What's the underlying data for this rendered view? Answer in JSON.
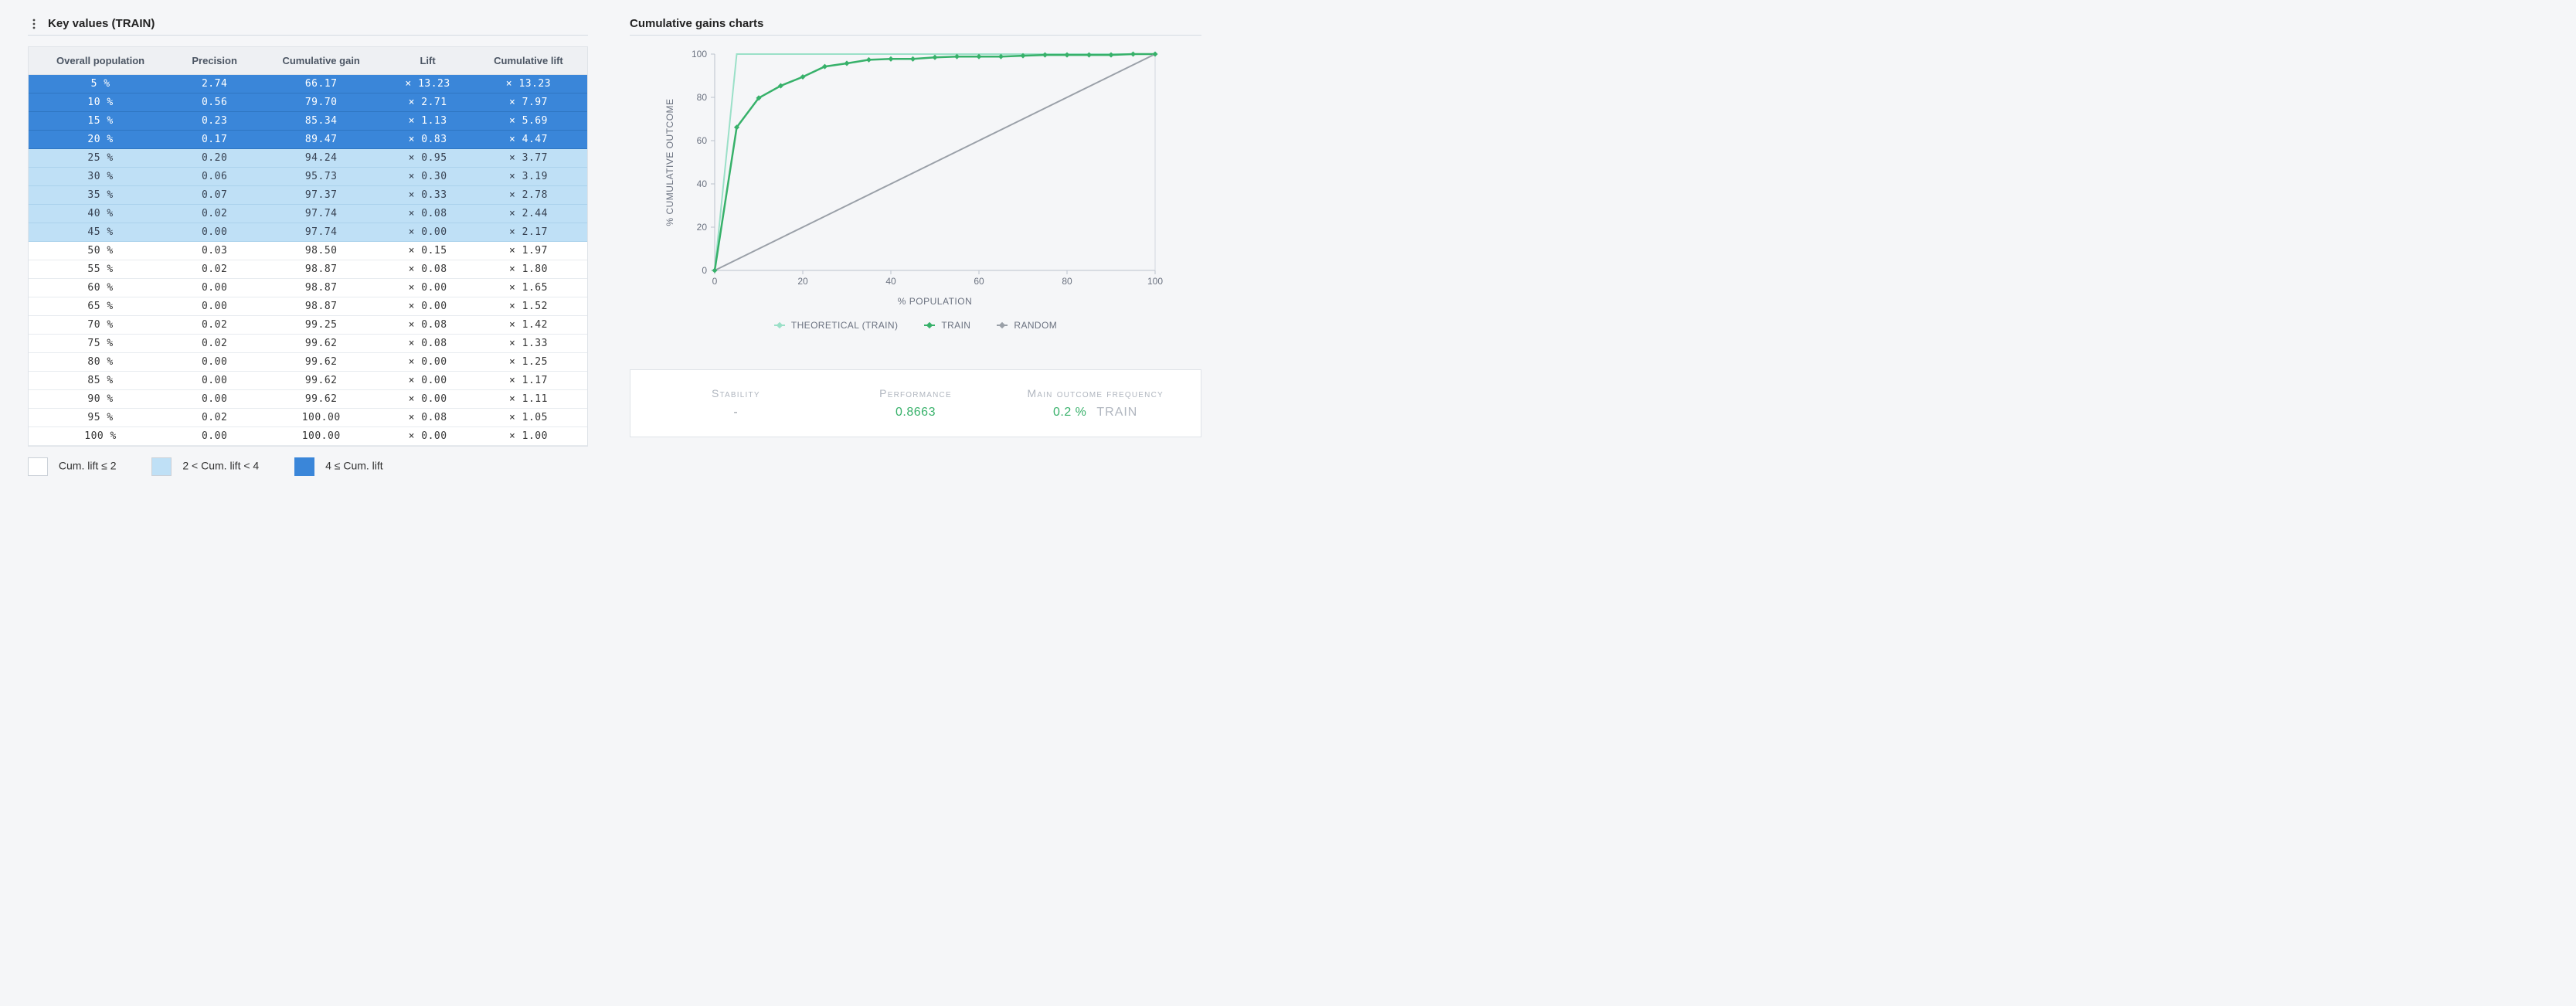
{
  "colors": {
    "band_high": "#3a86d9",
    "band_mid": "#bfe0f6",
    "band_low": "#ffffff",
    "series_train": "#37b16a",
    "series_theoretical": "#9be0c8",
    "series_random": "#9aa0a8"
  },
  "left": {
    "title": "Key values (TRAIN)",
    "columns": [
      "Overall population",
      "Precision",
      "Cumulative gain",
      "Lift",
      "Cumulative lift"
    ],
    "rows": [
      {
        "pop": "5 %",
        "precision": "2.74",
        "cum_gain": "66.17",
        "lift": "× 13.23",
        "cum_lift": "× 13.23",
        "band": "high"
      },
      {
        "pop": "10 %",
        "precision": "0.56",
        "cum_gain": "79.70",
        "lift": "× 2.71",
        "cum_lift": "× 7.97",
        "band": "high"
      },
      {
        "pop": "15 %",
        "precision": "0.23",
        "cum_gain": "85.34",
        "lift": "× 1.13",
        "cum_lift": "× 5.69",
        "band": "high"
      },
      {
        "pop": "20 %",
        "precision": "0.17",
        "cum_gain": "89.47",
        "lift": "× 0.83",
        "cum_lift": "× 4.47",
        "band": "high"
      },
      {
        "pop": "25 %",
        "precision": "0.20",
        "cum_gain": "94.24",
        "lift": "× 0.95",
        "cum_lift": "× 3.77",
        "band": "mid"
      },
      {
        "pop": "30 %",
        "precision": "0.06",
        "cum_gain": "95.73",
        "lift": "× 0.30",
        "cum_lift": "× 3.19",
        "band": "mid"
      },
      {
        "pop": "35 %",
        "precision": "0.07",
        "cum_gain": "97.37",
        "lift": "× 0.33",
        "cum_lift": "× 2.78",
        "band": "mid"
      },
      {
        "pop": "40 %",
        "precision": "0.02",
        "cum_gain": "97.74",
        "lift": "× 0.08",
        "cum_lift": "× 2.44",
        "band": "mid"
      },
      {
        "pop": "45 %",
        "precision": "0.00",
        "cum_gain": "97.74",
        "lift": "× 0.00",
        "cum_lift": "× 2.17",
        "band": "mid"
      },
      {
        "pop": "50 %",
        "precision": "0.03",
        "cum_gain": "98.50",
        "lift": "× 0.15",
        "cum_lift": "× 1.97",
        "band": "low"
      },
      {
        "pop": "55 %",
        "precision": "0.02",
        "cum_gain": "98.87",
        "lift": "× 0.08",
        "cum_lift": "× 1.80",
        "band": "low"
      },
      {
        "pop": "60 %",
        "precision": "0.00",
        "cum_gain": "98.87",
        "lift": "× 0.00",
        "cum_lift": "× 1.65",
        "band": "low"
      },
      {
        "pop": "65 %",
        "precision": "0.00",
        "cum_gain": "98.87",
        "lift": "× 0.00",
        "cum_lift": "× 1.52",
        "band": "low"
      },
      {
        "pop": "70 %",
        "precision": "0.02",
        "cum_gain": "99.25",
        "lift": "× 0.08",
        "cum_lift": "× 1.42",
        "band": "low"
      },
      {
        "pop": "75 %",
        "precision": "0.02",
        "cum_gain": "99.62",
        "lift": "× 0.08",
        "cum_lift": "× 1.33",
        "band": "low"
      },
      {
        "pop": "80 %",
        "precision": "0.00",
        "cum_gain": "99.62",
        "lift": "× 0.00",
        "cum_lift": "× 1.25",
        "band": "low"
      },
      {
        "pop": "85 %",
        "precision": "0.00",
        "cum_gain": "99.62",
        "lift": "× 0.00",
        "cum_lift": "× 1.17",
        "band": "low"
      },
      {
        "pop": "90 %",
        "precision": "0.00",
        "cum_gain": "99.62",
        "lift": "× 0.00",
        "cum_lift": "× 1.11",
        "band": "low"
      },
      {
        "pop": "95 %",
        "precision": "0.02",
        "cum_gain": "100.00",
        "lift": "× 0.08",
        "cum_lift": "× 1.05",
        "band": "low"
      },
      {
        "pop": "100 %",
        "precision": "0.00",
        "cum_gain": "100.00",
        "lift": "× 0.00",
        "cum_lift": "× 1.00",
        "band": "low"
      }
    ],
    "legend": {
      "low": "Cum. lift ≤ 2",
      "mid": "2 < Cum. lift < 4",
      "high": "4 ≤ Cum. lift"
    }
  },
  "right": {
    "title": "Cumulative gains charts",
    "xlabel": "% POPULATION",
    "ylabel": "% CUMULATIVE OUTCOME",
    "xticks": [
      0,
      20,
      40,
      60,
      80,
      100
    ],
    "yticks": [
      0,
      20,
      40,
      60,
      80,
      100
    ],
    "legend": {
      "theoretical": "THEORETICAL (TRAIN)",
      "train": "TRAIN",
      "random": "RANDOM"
    },
    "stats": {
      "stability_label": "Stability",
      "stability_value": "-",
      "performance_label": "Performance",
      "performance_value": "0.8663",
      "mof_label": "Main outcome frequency",
      "mof_value": "0.2 %",
      "mof_unit": "TRAIN"
    }
  },
  "chart_data": {
    "type": "line",
    "title": "Cumulative gains charts",
    "xlabel": "% POPULATION",
    "ylabel": "% CUMULATIVE OUTCOME",
    "xlim": [
      0,
      100
    ],
    "ylim": [
      0,
      100
    ],
    "x": [
      0,
      5,
      10,
      15,
      20,
      25,
      30,
      35,
      40,
      45,
      50,
      55,
      60,
      65,
      70,
      75,
      80,
      85,
      90,
      95,
      100
    ],
    "series": [
      {
        "name": "THEORETICAL (TRAIN)",
        "values": [
          0,
          100,
          100,
          100,
          100,
          100,
          100,
          100,
          100,
          100,
          100,
          100,
          100,
          100,
          100,
          100,
          100,
          100,
          100,
          100,
          100
        ]
      },
      {
        "name": "TRAIN",
        "values": [
          0,
          66.17,
          79.7,
          85.34,
          89.47,
          94.24,
          95.73,
          97.37,
          97.74,
          97.74,
          98.5,
          98.87,
          98.87,
          98.87,
          99.25,
          99.62,
          99.62,
          99.62,
          99.62,
          100.0,
          100.0
        ]
      },
      {
        "name": "RANDOM",
        "values": [
          0,
          5,
          10,
          15,
          20,
          25,
          30,
          35,
          40,
          45,
          50,
          55,
          60,
          65,
          70,
          75,
          80,
          85,
          90,
          95,
          100
        ]
      }
    ]
  }
}
